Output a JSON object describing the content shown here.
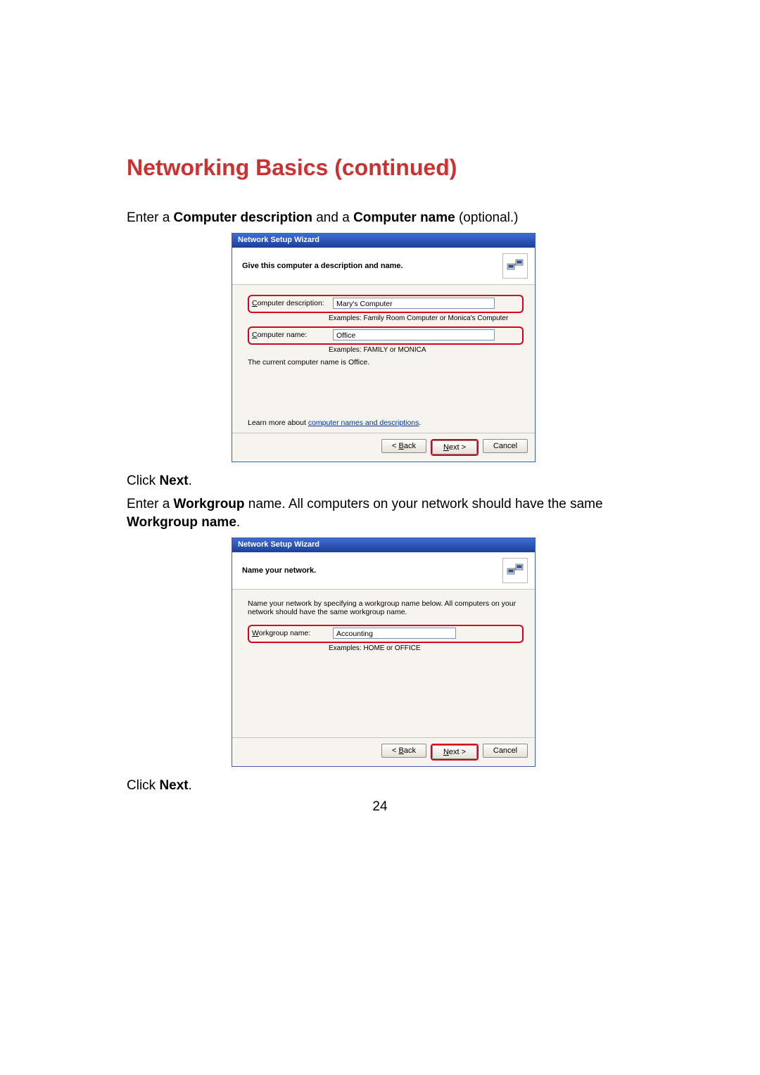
{
  "page": {
    "title": "Networking Basics (continued)",
    "number": "24"
  },
  "intro1_a": "Enter a ",
  "intro1_b": "Computer description",
  "intro1_c": " and a ",
  "intro1_d": "Computer name",
  "intro1_e": " (optional.)",
  "click_next_a": "Click ",
  "click_next_b": "Next",
  "click_next_c": ".",
  "intro2_a": "Enter a ",
  "intro2_b": "Workgroup",
  "intro2_c": " name.  All computers on your network should have the same ",
  "intro2_d": "Workgroup name",
  "intro2_e": ".",
  "wizard1": {
    "title": "Network Setup Wizard",
    "heading": "Give this computer a description and name.",
    "desc_label_pre": "C",
    "desc_label_post": "omputer description:",
    "desc_value": "Mary's Computer",
    "desc_example": "Examples: Family Room Computer or Monica's Computer",
    "name_label_pre": "C",
    "name_label_post": "omputer name:",
    "name_value": "Office",
    "name_example": "Examples: FAMILY or MONICA",
    "current": "The current computer name is Office.",
    "learn_pre": "Learn more about ",
    "learn_link": "computer names and descriptions",
    "learn_post": ".",
    "back": "< Back",
    "next": "Next >",
    "cancel": "Cancel"
  },
  "wizard2": {
    "title": "Network Setup Wizard",
    "heading": "Name your network.",
    "instruct": "Name your network by specifying a workgroup name below. All computers on your network should have the same workgroup name.",
    "wg_label_pre": "W",
    "wg_label_post": "orkgroup name:",
    "wg_value": "Accounting",
    "wg_example": "Examples: HOME or OFFICE",
    "back": "< Back",
    "next": "Next >",
    "cancel": "Cancel"
  }
}
